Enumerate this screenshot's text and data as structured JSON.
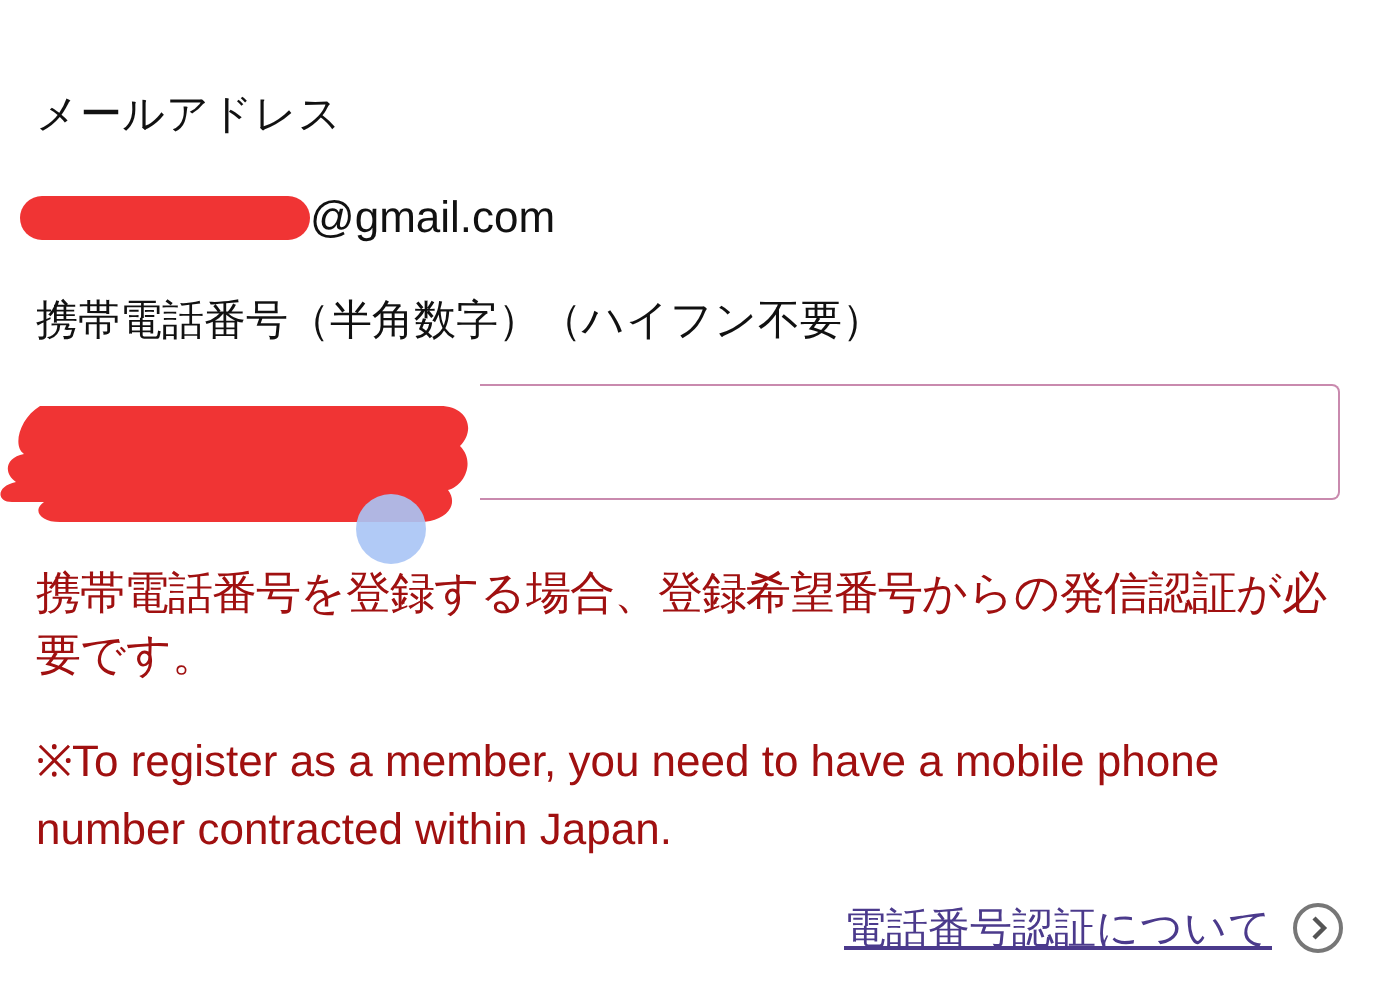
{
  "email": {
    "label": "メールアドレス",
    "value": "@gmail.com"
  },
  "phone": {
    "label": "携帯電話番号（半角数字）（ハイフン不要）"
  },
  "notices": [
    "携帯電話番号を登録する場合、登録希望番号からの発信認証が必要です。",
    "※To register as a member, you need to have a mobile phone number contracted within Japan."
  ],
  "link": {
    "label": "電話番号認証について"
  }
}
